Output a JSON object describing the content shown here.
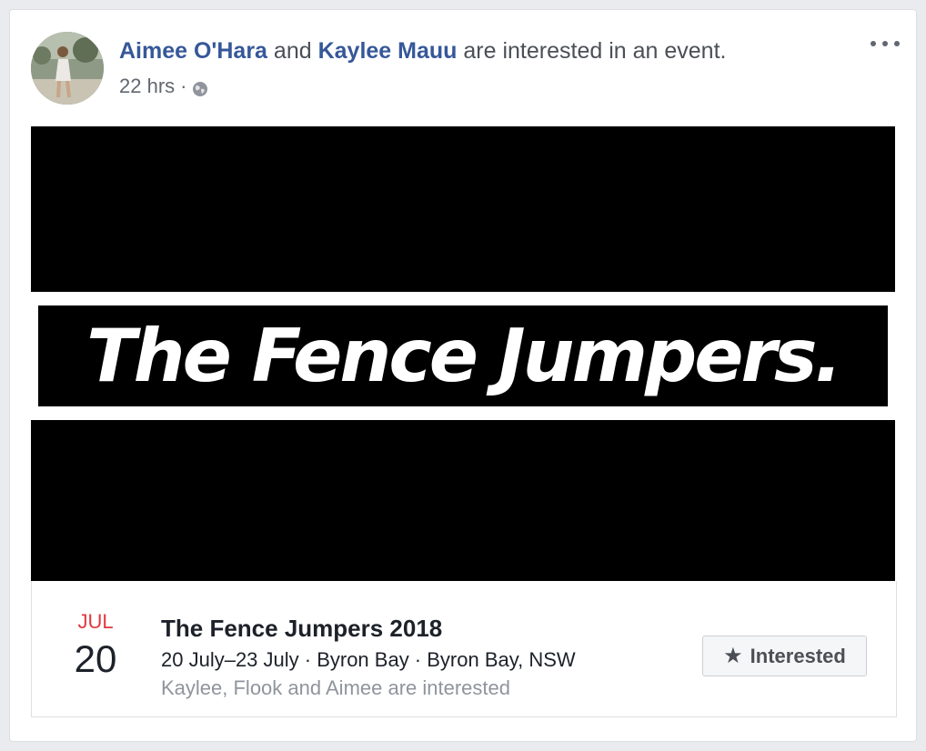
{
  "story": {
    "actors": [
      "Aimee O'Hara",
      "Kaylee Mauu"
    ],
    "connector": "and",
    "action": "are interested in an event.",
    "timestamp": "22 hrs",
    "separator": "·",
    "audience_icon": "globe-icon",
    "more_icon": "more-options-icon"
  },
  "banner": {
    "text": "The Fence Jumpers."
  },
  "event": {
    "month": "JUL",
    "day": "20",
    "title": "The Fence Jumpers 2018",
    "details": "20 July–23 July · Byron Bay · Byron Bay, NSW",
    "social": "Kaylee, Flook and Aimee are interested",
    "button_icon": "star-icon",
    "button_label": "Interested"
  },
  "colors": {
    "link": "#365899",
    "month": "#e0393e",
    "secondary_text": "#90949c",
    "page_background": "#e9ebee"
  }
}
